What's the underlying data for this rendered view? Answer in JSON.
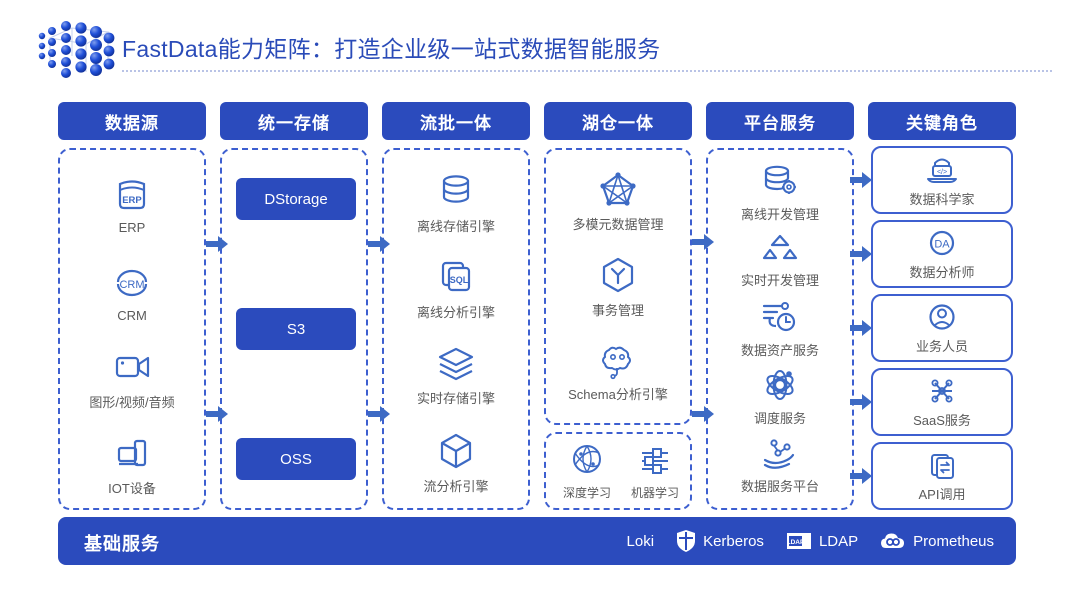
{
  "header": {
    "title": "FastData能力矩阵：打造企业级一站式数据智能服务",
    "logo_icon": "molecule-cube-logo"
  },
  "colors": {
    "brand_blue": "#2b4bbd",
    "dashed_border": "#3d5fd0",
    "icon_blue": "#3d6ac4",
    "label_gray": "#5a5a5a",
    "title_blue": "#2a4bb8"
  },
  "columns": [
    {
      "id": "data-source",
      "header": "数据源",
      "items": [
        {
          "label": "ERP",
          "icon": "erp-box-icon"
        },
        {
          "label": "CRM",
          "icon": "crm-circle-icon"
        },
        {
          "label": "图形/视频/音频",
          "icon": "video-camera-icon"
        },
        {
          "label": "IOT设备",
          "icon": "iot-device-icon"
        }
      ]
    },
    {
      "id": "unified-storage",
      "header": "统一存储",
      "items": [
        {
          "label": "DStorage",
          "icon": "pill-button"
        },
        {
          "label": "S3",
          "icon": "pill-button"
        },
        {
          "label": "OSS",
          "icon": "pill-button"
        }
      ]
    },
    {
      "id": "stream-batch",
      "header": "流批一体",
      "items": [
        {
          "label": "离线存储引擎",
          "icon": "database-icon"
        },
        {
          "label": "离线分析引擎",
          "icon": "sql-files-icon"
        },
        {
          "label": "实时存储引擎",
          "icon": "layers-icon"
        },
        {
          "label": "流分析引擎",
          "icon": "cube-icon"
        }
      ]
    },
    {
      "id": "lake-house",
      "header": "湖仓一体",
      "items": [
        {
          "label": "多模元数据管理",
          "icon": "pentagon-network-icon"
        },
        {
          "label": "事务管理",
          "icon": "hexagon-y-icon"
        },
        {
          "label": "Schema分析引擎",
          "icon": "brain-icon"
        }
      ],
      "sub_items": [
        {
          "label": "深度学习",
          "icon": "globe-network-icon"
        },
        {
          "label": "机器学习",
          "icon": "sliders-icon"
        }
      ]
    },
    {
      "id": "platform-service",
      "header": "平台服务",
      "items": [
        {
          "label": "离线开发管理",
          "icon": "database-gear-icon"
        },
        {
          "label": "实时开发管理",
          "icon": "blocks-icon"
        },
        {
          "label": "数据资产服务",
          "icon": "flow-clock-icon"
        },
        {
          "label": "调度服务",
          "icon": "atom-icon"
        },
        {
          "label": "数据服务平台",
          "icon": "hand-data-icon"
        }
      ]
    },
    {
      "id": "key-roles",
      "header": "关键角色",
      "items": [
        {
          "label": "数据科学家",
          "icon": "scientist-laptop-icon"
        },
        {
          "label": "数据分析师",
          "icon": "da-circle-icon"
        },
        {
          "label": "业务人员",
          "icon": "user-circle-icon"
        },
        {
          "label": "SaaS服务",
          "icon": "saas-network-icon"
        },
        {
          "label": "API调用",
          "icon": "api-exchange-icon"
        }
      ]
    }
  ],
  "footer": {
    "title": "基础服务",
    "items": [
      {
        "label": "Loki",
        "icon": "none"
      },
      {
        "label": "Kerberos",
        "icon": "shield-icon"
      },
      {
        "label": "LDAP",
        "icon": "ldap-tag-icon"
      },
      {
        "label": "Prometheus",
        "icon": "prometheus-cloud-icon"
      }
    ]
  }
}
